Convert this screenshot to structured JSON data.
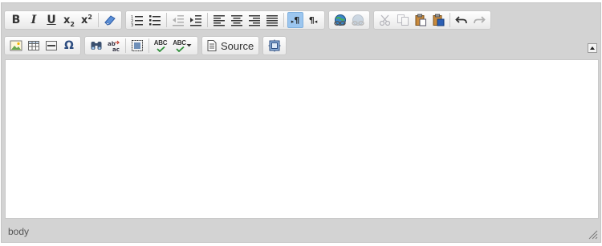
{
  "toolbar": {
    "source_label": "Source"
  },
  "icons": {
    "bold": "B",
    "italic": "I",
    "underline": "U",
    "subscript_base": "x",
    "subscript_mark": "2",
    "superscript_base": "x",
    "superscript_mark": "2",
    "spellcheck": "ABC",
    "scayt": "ABC",
    "omega": "Ω",
    "pilcrow": "¶"
  },
  "statusbar": {
    "path": "body"
  },
  "colors": {
    "active_button": "#9cc6ef",
    "editor_chrome": "#d3d3d3",
    "content_background": "#ffffff"
  }
}
